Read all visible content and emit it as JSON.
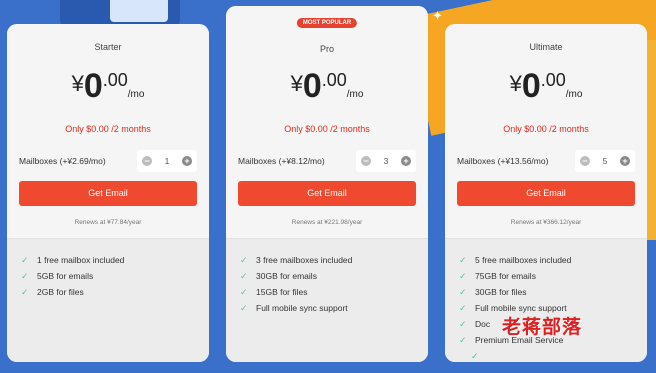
{
  "plans": [
    {
      "badge": "",
      "name": "Starter",
      "price": {
        "currency": "¥",
        "whole": "0",
        "decimal": ".00",
        "period": "/mo"
      },
      "promo": "Only $0.00 /2 months",
      "mailbox_label": "Mailboxes (+¥2.69/mo)",
      "mailbox_count": "1",
      "cta": "Get Email",
      "renew": "Renews at ¥77.84/year",
      "features": [
        "1 free mailbox included",
        "5GB for emails",
        "2GB for files"
      ]
    },
    {
      "badge": "MOST POPULAR",
      "name": "Pro",
      "price": {
        "currency": "¥",
        "whole": "0",
        "decimal": ".00",
        "period": "/mo"
      },
      "promo": "Only $0.00 /2 months",
      "mailbox_label": "Mailboxes (+¥8.12/mo)",
      "mailbox_count": "3",
      "cta": "Get Email",
      "renew": "Renews at ¥221.98/year",
      "features": [
        "3 free mailboxes included",
        "30GB for emails",
        "15GB for files",
        "Full mobile sync support"
      ]
    },
    {
      "badge": "",
      "name": "Ultimate",
      "price": {
        "currency": "¥",
        "whole": "0",
        "decimal": ".00",
        "period": "/mo"
      },
      "promo": "Only $0.00 /2 months",
      "mailbox_label": "Mailboxes (+¥13.56/mo)",
      "mailbox_count": "5",
      "cta": "Get Email",
      "renew": "Renews at ¥366.12/year",
      "features": [
        "5 free mailboxes included",
        "75GB for emails",
        "30GB for files",
        "Full mobile sync support",
        "Doc",
        "Premium Email Service",
        "",
        ""
      ]
    }
  ],
  "watermark": "老蒋部落",
  "colors": {
    "accent": "#ef4a2f",
    "promo": "#e02a1b",
    "check": "#5bbf96",
    "background": "#3a70c9"
  }
}
